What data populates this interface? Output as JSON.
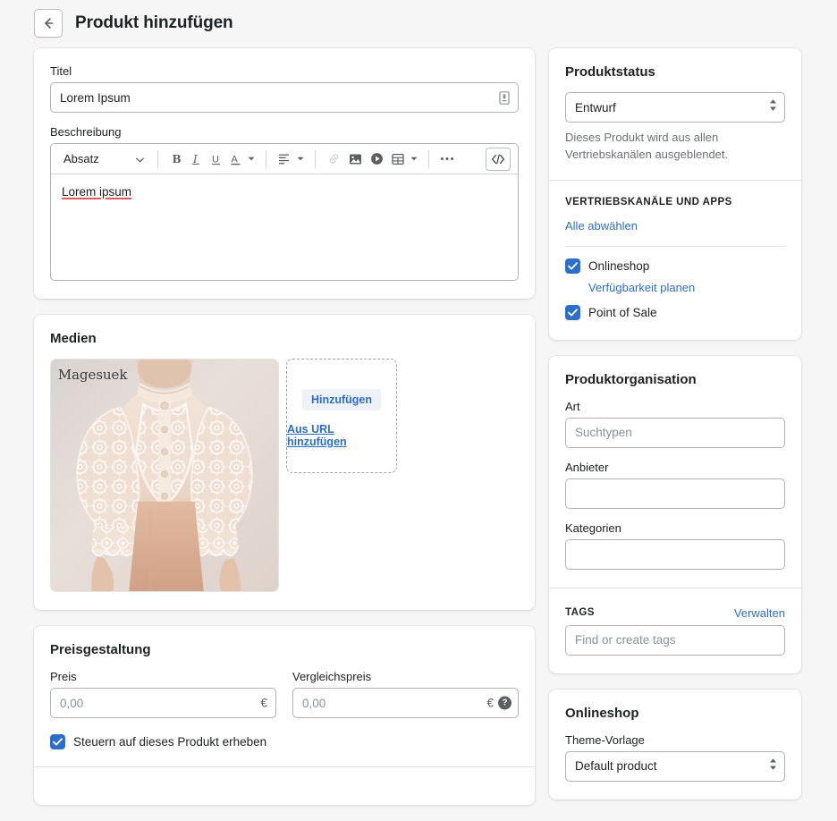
{
  "header": {
    "back_icon": "arrow-left-icon",
    "title": "Produkt hinzufügen"
  },
  "main": {
    "title_field": {
      "label": "Titel",
      "value": "Lorem Ipsum",
      "trailing_icon": "document-icon"
    },
    "description_field": {
      "label": "Beschreibung",
      "body_text": "Lorem ipsum",
      "toolbar": {
        "block_format": "Absatz",
        "bold": "B",
        "italic": "I",
        "underline": "U",
        "text_color": "A",
        "align_icon": "align-left-icon",
        "link_icon": "link-icon",
        "image_icon": "image-icon",
        "video_icon": "video-icon",
        "table_icon": "table-icon",
        "more_icon": "ellipsis-icon",
        "code_icon": "code-icon"
      }
    },
    "media": {
      "title": "Medien",
      "thumb_watermark": "Magesuek",
      "add_button": "Hinzufügen",
      "add_url_link": "Aus URL hinzufügen"
    },
    "pricing": {
      "title": "Preisgestaltung",
      "price": {
        "label": "Preis",
        "placeholder": "0,00",
        "currency": "€"
      },
      "compare_price": {
        "label": "Vergleichspreis",
        "placeholder": "0,00",
        "currency": "€",
        "help_icon": "?"
      },
      "tax_checkbox": {
        "label": "Steuern auf dieses Produkt erheben",
        "checked": true
      }
    }
  },
  "sidebar": {
    "status": {
      "title": "Produktstatus",
      "select_value": "Entwurf",
      "help_text": "Dieses Produkt wird aus allen Vertriebskanälen ausgeblendet.",
      "channels_heading": "VERTRIEBSKANÄLE UND APPS",
      "deselect_all": "Alle abwählen",
      "channels": [
        {
          "label": "Onlineshop",
          "checked": true,
          "sub_link": "Verfügbarkeit planen"
        },
        {
          "label": "Point of Sale",
          "checked": true,
          "sub_link": null
        }
      ]
    },
    "organization": {
      "title": "Produktorganisation",
      "type": {
        "label": "Art",
        "placeholder": "Suchtypen",
        "value": ""
      },
      "vendor": {
        "label": "Anbieter",
        "placeholder": "",
        "value": ""
      },
      "categories": {
        "label": "Kategorien",
        "placeholder": "",
        "value": ""
      },
      "tags": {
        "heading": "TAGS",
        "manage_link": "Verwalten",
        "placeholder": "Find or create tags",
        "value": ""
      }
    },
    "onlineshop": {
      "title": "Onlineshop",
      "theme_label": "Theme-Vorlage",
      "theme_value": "Default product"
    }
  },
  "colors": {
    "page_bg": "#f6f6f7",
    "card_bg": "#ffffff",
    "accent_blue": "#2c6ecb",
    "checkbox_blue": "#2c6ecb",
    "text_primary": "#202223",
    "text_subdued": "#6d7175",
    "border": "#aeb4b9",
    "spellcheck_red": "#e35b5b"
  }
}
